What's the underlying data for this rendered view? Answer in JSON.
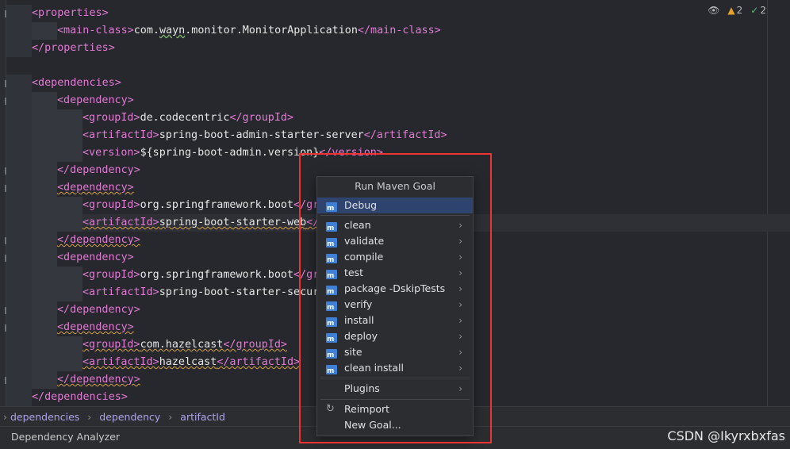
{
  "editor": {
    "lines": [
      {
        "indent": 1,
        "parts": [
          {
            "t": "<properties>",
            "c": "tag"
          }
        ]
      },
      {
        "indent": 2,
        "parts": [
          {
            "t": "<main-class>",
            "c": "tag"
          },
          {
            "t": "com.",
            "c": "txt"
          },
          {
            "t": "wayn",
            "c": "txt wavy-green"
          },
          {
            "t": ".monitor.MonitorApplication",
            "c": "txt"
          },
          {
            "t": "</main-class>",
            "c": "tag"
          }
        ]
      },
      {
        "indent": 1,
        "parts": [
          {
            "t": "</properties>",
            "c": "tag"
          }
        ]
      },
      {
        "indent": 0,
        "parts": []
      },
      {
        "indent": 1,
        "parts": [
          {
            "t": "<dependencies>",
            "c": "tag"
          }
        ]
      },
      {
        "indent": 2,
        "parts": [
          {
            "t": "<dependency>",
            "c": "tag"
          }
        ]
      },
      {
        "indent": 3,
        "parts": [
          {
            "t": "<groupId>",
            "c": "tag"
          },
          {
            "t": "de.codecentric",
            "c": "txt"
          },
          {
            "t": "</groupId>",
            "c": "tag"
          }
        ]
      },
      {
        "indent": 3,
        "parts": [
          {
            "t": "<artifactId>",
            "c": "tag"
          },
          {
            "t": "spring-boot-admin-starter-server",
            "c": "txt"
          },
          {
            "t": "</artifactId>",
            "c": "tag"
          }
        ]
      },
      {
        "indent": 3,
        "parts": [
          {
            "t": "<version>",
            "c": "tag"
          },
          {
            "t": "${spring-boot-admin.version}",
            "c": "txt"
          },
          {
            "t": "</version>",
            "c": "tag"
          }
        ]
      },
      {
        "indent": 2,
        "parts": [
          {
            "t": "</dependency>",
            "c": "tag"
          }
        ]
      },
      {
        "indent": 2,
        "parts": [
          {
            "t": "<dependency>",
            "c": "tag wavy"
          }
        ]
      },
      {
        "indent": 3,
        "parts": [
          {
            "t": "<groupId>",
            "c": "tag"
          },
          {
            "t": "org.springframework.boot",
            "c": "txt"
          },
          {
            "t": "</gr",
            "c": "tag"
          }
        ]
      },
      {
        "indent": 3,
        "parts": [
          {
            "t": "<artifactId>",
            "c": "tag"
          },
          {
            "t": "spring-boot-starter-web",
            "c": "txt"
          },
          {
            "t": "</",
            "c": "tag"
          }
        ],
        "wavy": true,
        "current": true
      },
      {
        "indent": 2,
        "parts": [
          {
            "t": "</dependency>",
            "c": "tag wavy"
          }
        ]
      },
      {
        "indent": 2,
        "parts": [
          {
            "t": "<dependency>",
            "c": "tag"
          }
        ]
      },
      {
        "indent": 3,
        "parts": [
          {
            "t": "<groupId>",
            "c": "tag"
          },
          {
            "t": "org.springframework.boot",
            "c": "txt"
          },
          {
            "t": "</gr",
            "c": "tag"
          }
        ]
      },
      {
        "indent": 3,
        "parts": [
          {
            "t": "<artifactId>",
            "c": "tag"
          },
          {
            "t": "spring-boot-starter-secur",
            "c": "txt"
          }
        ]
      },
      {
        "indent": 2,
        "parts": [
          {
            "t": "</dependency>",
            "c": "tag"
          }
        ]
      },
      {
        "indent": 2,
        "parts": [
          {
            "t": "<dependency>",
            "c": "tag wavy"
          }
        ]
      },
      {
        "indent": 3,
        "parts": [
          {
            "t": "<groupId>",
            "c": "tag"
          },
          {
            "t": "com.hazelcast",
            "c": "txt"
          },
          {
            "t": "</groupId>",
            "c": "tag"
          }
        ],
        "wavy": true
      },
      {
        "indent": 3,
        "parts": [
          {
            "t": "<artifactId>",
            "c": "tag"
          },
          {
            "t": "hazelcast",
            "c": "txt"
          },
          {
            "t": "</artifactId>",
            "c": "tag"
          }
        ],
        "wavy": true
      },
      {
        "indent": 2,
        "parts": [
          {
            "t": "</dependency>",
            "c": "tag wavy"
          }
        ]
      },
      {
        "indent": 1,
        "parts": [
          {
            "t": "</dependencies>",
            "c": "tag"
          }
        ]
      }
    ]
  },
  "inspection": {
    "warnings": "2",
    "ok": "2",
    "warn_icon": "warning-triangle-icon",
    "ok_icon": "check-icon"
  },
  "breadcrumbs": [
    "dependencies",
    "dependency",
    "artifactId"
  ],
  "bottom_tool": "Dependency Analyzer",
  "watermark": "CSDN @Ikyrxbxfas",
  "popup": {
    "title": "Run Maven Goal",
    "items": [
      {
        "label": "Debug",
        "selected": true,
        "arrow": false
      },
      {
        "label": "clean",
        "arrow": true
      },
      {
        "label": "validate",
        "arrow": true
      },
      {
        "label": "compile",
        "arrow": true
      },
      {
        "label": "test",
        "arrow": true
      },
      {
        "label": "package -DskipTests",
        "arrow": true
      },
      {
        "label": "verify",
        "arrow": true
      },
      {
        "label": "install",
        "arrow": true
      },
      {
        "label": "deploy",
        "arrow": true
      },
      {
        "label": "site",
        "arrow": true
      },
      {
        "label": "clean install",
        "arrow": true
      }
    ],
    "plugins": "Plugins",
    "reimport": "Reimport",
    "new_goal": "New Goal..."
  },
  "colors": {
    "tag": "#e07bd3",
    "text": "#e6e6e6",
    "highlight_border": "#ee3333",
    "selection": "#2e436e"
  }
}
